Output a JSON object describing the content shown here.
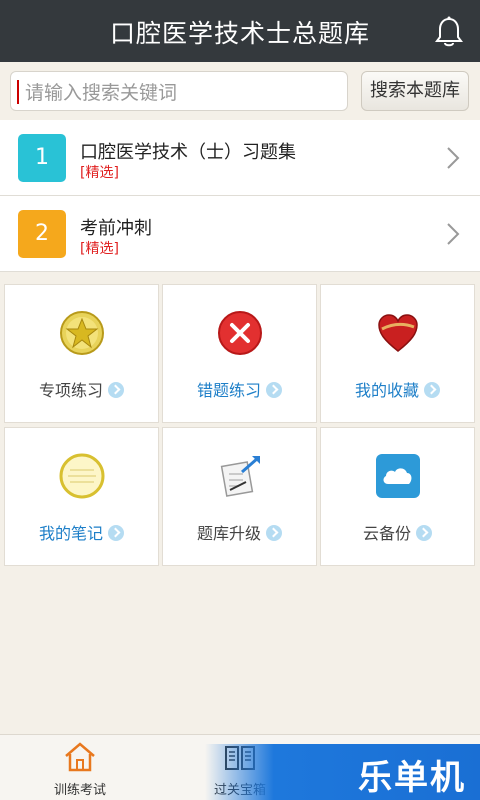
{
  "header": {
    "title": "口腔医学技术士总题库",
    "icon": "bell-icon"
  },
  "search": {
    "placeholder": "请输入搜索关键词",
    "button_label": "搜索本题库"
  },
  "list": [
    {
      "number": "1",
      "name": "口腔医学技术（士）习题集",
      "tag": "[精选]",
      "color": "#29c2d6"
    },
    {
      "number": "2",
      "name": "考前冲刺",
      "tag": "[精选]",
      "color": "#f5a81c"
    }
  ],
  "grid": [
    {
      "label": "专项练习",
      "icon": "star-medal-icon",
      "highlight": false
    },
    {
      "label": "错题练习",
      "icon": "red-x-icon",
      "highlight": true
    },
    {
      "label": "我的收藏",
      "icon": "heart-icon",
      "highlight": true
    },
    {
      "label": "我的笔记",
      "icon": "notepad-icon",
      "highlight": true
    },
    {
      "label": "题库升级",
      "icon": "upgrade-document-icon",
      "highlight": false
    },
    {
      "label": "云备份",
      "icon": "cloud-icon",
      "highlight": false
    }
  ],
  "bottom_nav": [
    {
      "label": "训练考试",
      "icon": "home-icon",
      "active": true
    },
    {
      "label": "过关宝箱",
      "icon": "book-icon",
      "active": false
    }
  ],
  "watermark": {
    "text": "乐单机"
  }
}
